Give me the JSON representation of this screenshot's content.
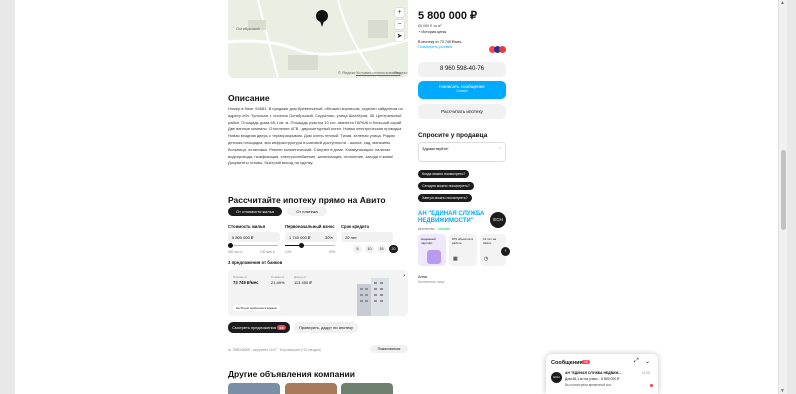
{
  "map": {
    "place": "Октябрьский",
    "copyright": "© Яндекс",
    "terms": "Условия использования",
    "brand": "Яндекс"
  },
  "listing": {
    "price": "5 800 000 ₽",
    "price_per_m2": "89 086 ₽ за м²",
    "price_history": "История цены",
    "mortgage": "В ипотеку от 73 749 ₽/мес.",
    "mortgage_link": "Посмотреть условия",
    "phone": "8 960 598-40-76",
    "write_btn": "Написать сообщение",
    "write_sub": "Онлайн",
    "calc_btn": "Рассчитать ипотеку"
  },
  "seller_q": {
    "title": "Спросите у продавца",
    "greeting": "Здравствуйте!",
    "chips": [
      "Когда можно посмотреть?",
      "Сегодня можно посмотреть?",
      "Завтра можно посмотреть?"
    ]
  },
  "agency": {
    "name": "АН \"ЕДИНАЯ СЛУЖБА НЕДВИЖИМОСТИ\"",
    "type": "Агентство",
    "status": "онлайн",
    "logo": "ЕСН",
    "features": [
      {
        "title": "Надежный партнёр"
      },
      {
        "title": "875 объектов в работе"
      },
      {
        "title": "12 лет на Авито"
      }
    ]
  },
  "person": {
    "name": "Анна",
    "role": "Контактное лицо"
  },
  "description": {
    "title": "Описание",
    "text": "Номер в базе: 54681. В продаже дом бревенчатый, обложен кирпичом, отделан сайдингом по адресу обл. Тульская, г. поселок Октябрьский, Скуратово, улица Шахтёров, 38. Центральный район. Площадь дома 65,1 кв. м. Площадь участка 10 сот. имеются ГАРАЖ и большой сарай. Две ванные комнаты. Отопление АГВ - двухконтурный котел. Новая электрическая проводка. Новая входная дверь с терморазрывом. Дом очень теплый. Тихая, зеленая улица. Рядом детская площадка, вся инфраструктура в шаговой доступности - школа, сад, магазины, больница, остановка. Ремонт косметический. Санузел в доме. Коммуникации: наличие водопровода, газификация, электроснабжение, канализация, отопление, заходи и живи! Документы готовы, быстрый выход на сделку."
  },
  "mortgage_block": {
    "title": "Рассчитайте ипотеку прямо на Авито",
    "tabs": [
      "От стоимости жилья",
      "От платежа"
    ],
    "labels": [
      "Стоимость жилья",
      "Первоначальный взнос",
      "Срок кредита"
    ],
    "values": [
      "5 800 000 ₽",
      "1 740 000 ₽",
      "30%",
      "20 лет"
    ],
    "ranges": [
      "500 тыс ₽",
      "100 млн ₽",
      "10%",
      "90%"
    ],
    "years": [
      "5",
      "10",
      "15",
      "20"
    ],
    "offers": "3 предложения от банков",
    "offer": {
      "k1": "Платёж от",
      "v1": "73 749 ₽/мес",
      "k2": "Ставка от",
      "v2": "21,49%",
      "k3": "Доход от",
      "v3": "113 450 ₽"
    },
    "note": "На 30 для одобрения в каждом",
    "see_btn": "Смотреть предложения",
    "check_btn": "Проверить, дадут ли ипотеку",
    "footer": "№ 7888148009 · загружено 14:07 · 8 просмотров (+10 сегодня)",
    "report": "Пожаловаться"
  },
  "other": {
    "title": "Другие объявления компании"
  },
  "chat": {
    "title": "Сообщения",
    "badge": "10",
    "sender": "АН \"ЕДИНАЯ СЛУЖБА НЕДВИЖ...",
    "time": "11:25",
    "line1": "Дом 65,1 м² на участ... 5 800 000 ₽",
    "line2": "Вы посмотрели временной зон..."
  },
  "colors": {
    "accent": "#00aaff",
    "brand_red": "#ff4053",
    "dark": "#1c1c1c"
  }
}
